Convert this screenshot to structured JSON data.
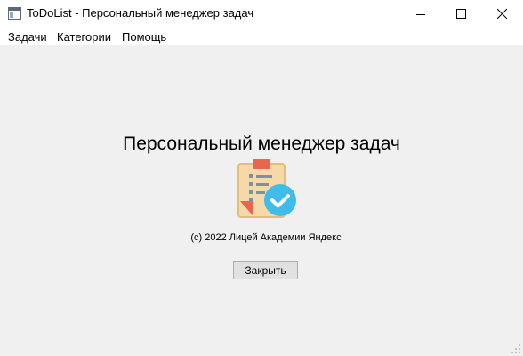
{
  "window": {
    "title": "ToDoList - Персональный менеджер задач"
  },
  "menu": {
    "items": [
      {
        "label": "Задачи"
      },
      {
        "label": "Категории"
      },
      {
        "label": "Помощь"
      }
    ]
  },
  "about": {
    "heading": "Персональный менеджер задач",
    "copyright": "(c) 2022 Лицей Академии Яндекс",
    "close_label": "Закрыть"
  },
  "icons": {
    "app": "app-window-icon",
    "logo": "clipboard-checklist-check-icon"
  },
  "colors": {
    "clipboard_body": "#f5d9a8",
    "clipboard_clip": "#e8654e",
    "check_circle": "#3fbce8",
    "list_lines": "#7d8fa0",
    "background": "#f0f0f0"
  }
}
